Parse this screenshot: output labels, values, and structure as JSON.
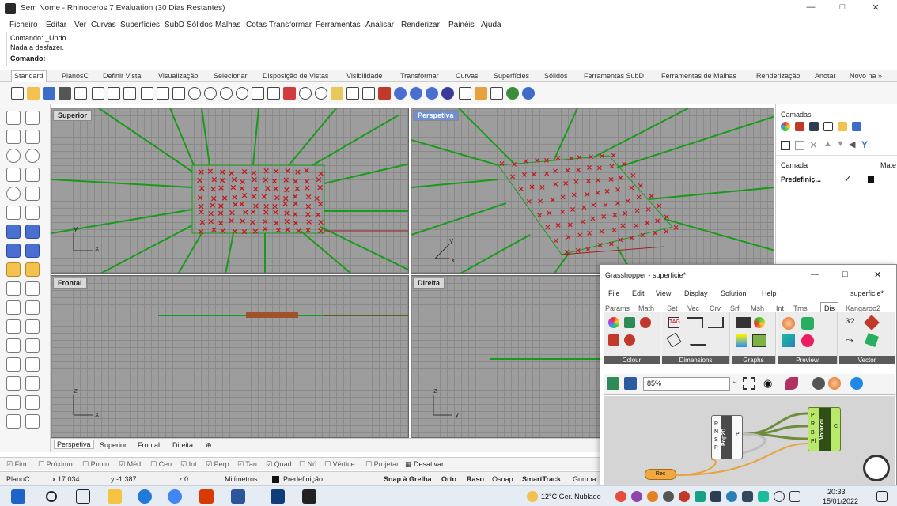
{
  "window": {
    "title": "Sem Nome - Rhinoceros 7 Evaluation (30 Dias Restantes)",
    "minimize": "—",
    "restore": "□",
    "close": "✕"
  },
  "menu": [
    "Ficheiro",
    "Editar",
    "Ver",
    "Curvas",
    "Superfícies",
    "SubD",
    "Sólidos",
    "Malhas",
    "Cotas",
    "Transformar",
    "Ferramentas",
    "Analisar",
    "Renderizar",
    "Painéis",
    "Ajuda"
  ],
  "command": {
    "history1": "Comando: _Undo",
    "history2": "Nada a desfazer.",
    "prompt": "Comando:"
  },
  "tabs": [
    "Standard",
    "PlanosC",
    "Definir Vista",
    "Visualização",
    "Selecionar",
    "Disposição de Vistas",
    "Visibilidade",
    "Transformar",
    "Curvas",
    "Superfícies",
    "Sólidos",
    "Ferramentas SubD",
    "Ferramentas de Malhas",
    "Renderização",
    "Anotar",
    "Novo na »"
  ],
  "viewports": {
    "top": "Superior",
    "perspective": "Perspetiva",
    "front": "Frontal",
    "right": "Direita"
  },
  "viewport_tabs": [
    "Perspetiva",
    "Superior",
    "Frontal",
    "Direita",
    "⊕"
  ],
  "osnap": [
    {
      "label": "Fim",
      "checked": true
    },
    {
      "label": "Próximo",
      "checked": false
    },
    {
      "label": "Ponto",
      "checked": false
    },
    {
      "label": "Méd",
      "checked": true
    },
    {
      "label": "Cen",
      "checked": false
    },
    {
      "label": "Int",
      "checked": true
    },
    {
      "label": "Perp",
      "checked": true
    },
    {
      "label": "Tan",
      "checked": true
    },
    {
      "label": "Quad",
      "checked": true
    },
    {
      "label": "Nó",
      "checked": false
    },
    {
      "label": "Vértice",
      "checked": false
    },
    {
      "label": "Projetar",
      "checked": false
    },
    {
      "label": "Desativar",
      "checked": false
    }
  ],
  "status": {
    "plane": "PlanoC",
    "x": "x 17.034",
    "y": "y -1.387",
    "z": "z 0",
    "units": "Milímetros",
    "layer": "Predefinição",
    "snap": "Snap à Grelha",
    "ortho": "Orto",
    "raso": "Raso",
    "osnap": "Osnap",
    "smarttrack": "SmartTrack",
    "gumball": "Gumba"
  },
  "layers": {
    "title": "Camadas",
    "col_layer": "Camada",
    "col_material": "Mate",
    "row_name": "Predefiniç...",
    "check": "✓"
  },
  "grasshopper": {
    "title": "Grasshopper - superficie*",
    "minimize": "—",
    "restore": "□",
    "close": "✕",
    "menu": [
      "File",
      "Edit",
      "View",
      "Display",
      "Solution",
      "Help"
    ],
    "doc": "superficie*",
    "tabs": [
      "Params",
      "Math",
      "Set",
      "Vec",
      "Crv",
      "Srf",
      "Msh",
      "Int",
      "Trns",
      "Dis",
      "Kangaroo2"
    ],
    "active_tab": "Dis",
    "groups": [
      "Colour",
      "Dimensions",
      "Graphs",
      "Preview",
      "Vector"
    ],
    "zoom": "85%",
    "components": {
      "pop2d": {
        "name": "Pop2D",
        "inputs": [
          "R",
          "N",
          "S",
          "P"
        ],
        "output": "P"
      },
      "voronoi": {
        "name": "Voronoi",
        "inputs": [
          "P",
          "R",
          "B",
          "Pl"
        ],
        "output": "C"
      },
      "rec": {
        "name": "Rec"
      }
    }
  },
  "taskbar": {
    "weather": "12°C Ger. Nublado",
    "time": "20:33",
    "date": "15/01/2022"
  },
  "colors": {
    "grid": "#9d9d9d",
    "voronoi": "#1a9a1a",
    "points": "#c4161c",
    "active_viewport": "#6f8fd1"
  }
}
